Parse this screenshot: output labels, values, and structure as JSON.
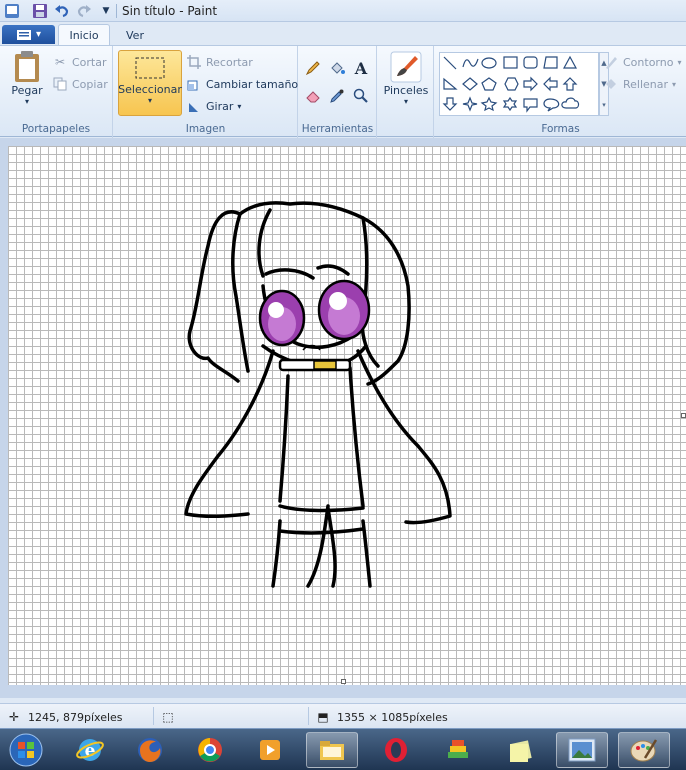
{
  "window": {
    "title": "Sin título - Paint"
  },
  "quick_access": [
    {
      "name": "paint-app-icon"
    },
    {
      "name": "save-icon"
    },
    {
      "name": "undo-icon"
    },
    {
      "name": "redo-icon"
    },
    {
      "name": "customize-dropdown-icon"
    }
  ],
  "tabs": [
    {
      "label": "Inicio",
      "active": true
    },
    {
      "label": "Ver",
      "active": false
    }
  ],
  "groups": {
    "clipboard": {
      "label": "Portapapeles",
      "paste": "Pegar",
      "cut": "Cortar",
      "copy": "Copiar"
    },
    "image": {
      "label": "Imagen",
      "select": "Seleccionar",
      "crop": "Recortar",
      "resize": "Cambiar tamaño",
      "rotate": "Girar"
    },
    "tools": {
      "label": "Herramientas",
      "items": [
        "pencil-icon",
        "fill-icon",
        "text-icon",
        "eraser-icon",
        "color-picker-icon",
        "magnifier-icon"
      ]
    },
    "brushes": {
      "label": "Pinceles"
    },
    "shapes": {
      "label": "Formas",
      "outline": "Contorno",
      "fill": "Rellenar",
      "items": [
        "line",
        "curve",
        "oval",
        "rectangle",
        "rounded-rectangle",
        "polygon",
        "triangle",
        "right-triangle",
        "diamond",
        "pentagon",
        "hexagon",
        "right-arrow",
        "left-arrow",
        "up-arrow",
        "down-arrow",
        "four-point-star",
        "five-point-star",
        "six-point-star",
        "rounded-callout",
        "oval-callout",
        "cloud-callout"
      ]
    }
  },
  "status": {
    "cursor": "1245, 879píxeles",
    "canvas_size": "1355 × 1085píxeles"
  },
  "taskbar": [
    {
      "name": "start-orb"
    },
    {
      "name": "internet-explorer-icon"
    },
    {
      "name": "firefox-icon"
    },
    {
      "name": "chrome-icon"
    },
    {
      "name": "media-player-icon"
    },
    {
      "name": "file-explorer-icon"
    },
    {
      "name": "opera-icon"
    },
    {
      "name": "bluestacks-icon"
    },
    {
      "name": "sticky-notes-icon"
    },
    {
      "name": "photo-viewer-icon"
    },
    {
      "name": "paint-taskbar-icon"
    }
  ],
  "colors": {
    "eye_purple": "#9b3fae",
    "eye_purple_light": "#c57ad3",
    "collar_yellow": "#e8c53a"
  }
}
